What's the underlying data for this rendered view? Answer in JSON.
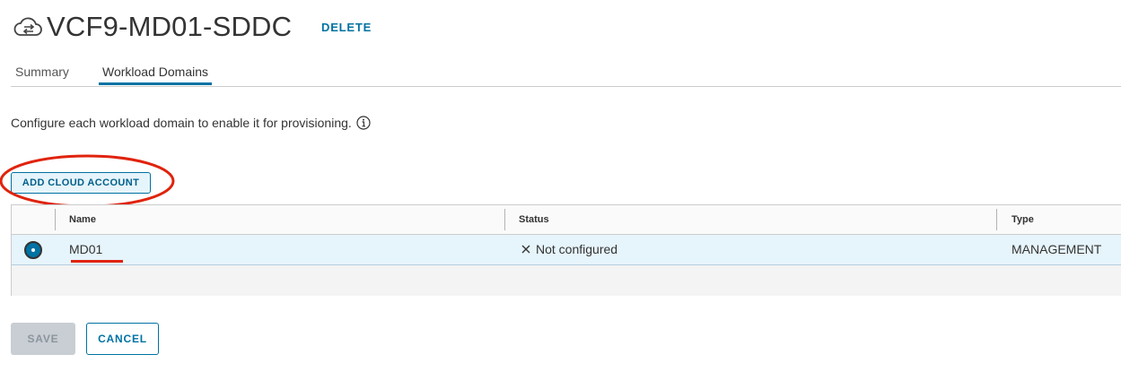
{
  "header": {
    "title": "VCF9-MD01-SDDC",
    "delete_label": "DELETE",
    "icon": "cloud-sync-icon"
  },
  "tabs": [
    {
      "label": "Summary",
      "active": false
    },
    {
      "label": "Workload Domains",
      "active": true
    }
  ],
  "helper_text": "Configure each workload domain to enable it for provisioning.",
  "add_button_label": "ADD CLOUD ACCOUNT",
  "grid": {
    "columns": [
      "Name",
      "Status",
      "Type"
    ],
    "rows": [
      {
        "selected": true,
        "name": "MD01",
        "status": "Not configured",
        "type": "MANAGEMENT"
      }
    ]
  },
  "footer": {
    "save_label": "SAVE",
    "cancel_label": "CANCEL"
  },
  "colors": {
    "accent": "#0072a3",
    "annotation": "#e0230d",
    "selected_row": "#e6f4fb"
  }
}
